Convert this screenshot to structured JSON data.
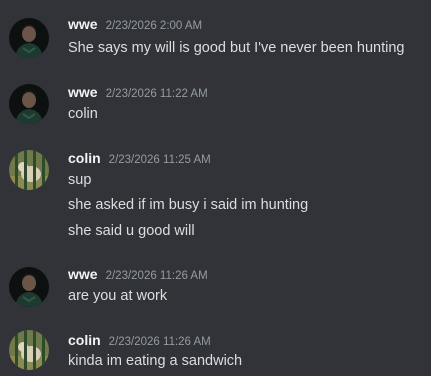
{
  "messages": [
    {
      "username": "wwe",
      "timestamp": "2/23/2026 2:00 AM",
      "avatar": "wwe-avatar",
      "lines": [
        "She says my will is good but I've never been hunting"
      ]
    },
    {
      "username": "wwe",
      "timestamp": "2/23/2026 11:22 AM",
      "avatar": "wwe-avatar",
      "lines": [
        "colin"
      ]
    },
    {
      "username": "colin",
      "timestamp": "2/23/2026 11:25 AM",
      "avatar": "colin-avatar",
      "lines": [
        "sup",
        "she asked if im busy i said im hunting",
        "she said u good will"
      ]
    },
    {
      "username": "wwe",
      "timestamp": "2/23/2026 11:26 AM",
      "avatar": "wwe-avatar",
      "lines": [
        "are you at work"
      ]
    },
    {
      "username": "colin",
      "timestamp": "2/23/2026 11:26 AM",
      "avatar": "colin-avatar",
      "lines": [
        "kinda im eating a sandwich"
      ]
    }
  ],
  "colors": {
    "background": "#313338",
    "username": "#f2f3f5",
    "timestamp": "#949ba4",
    "text": "#dbdee1"
  }
}
